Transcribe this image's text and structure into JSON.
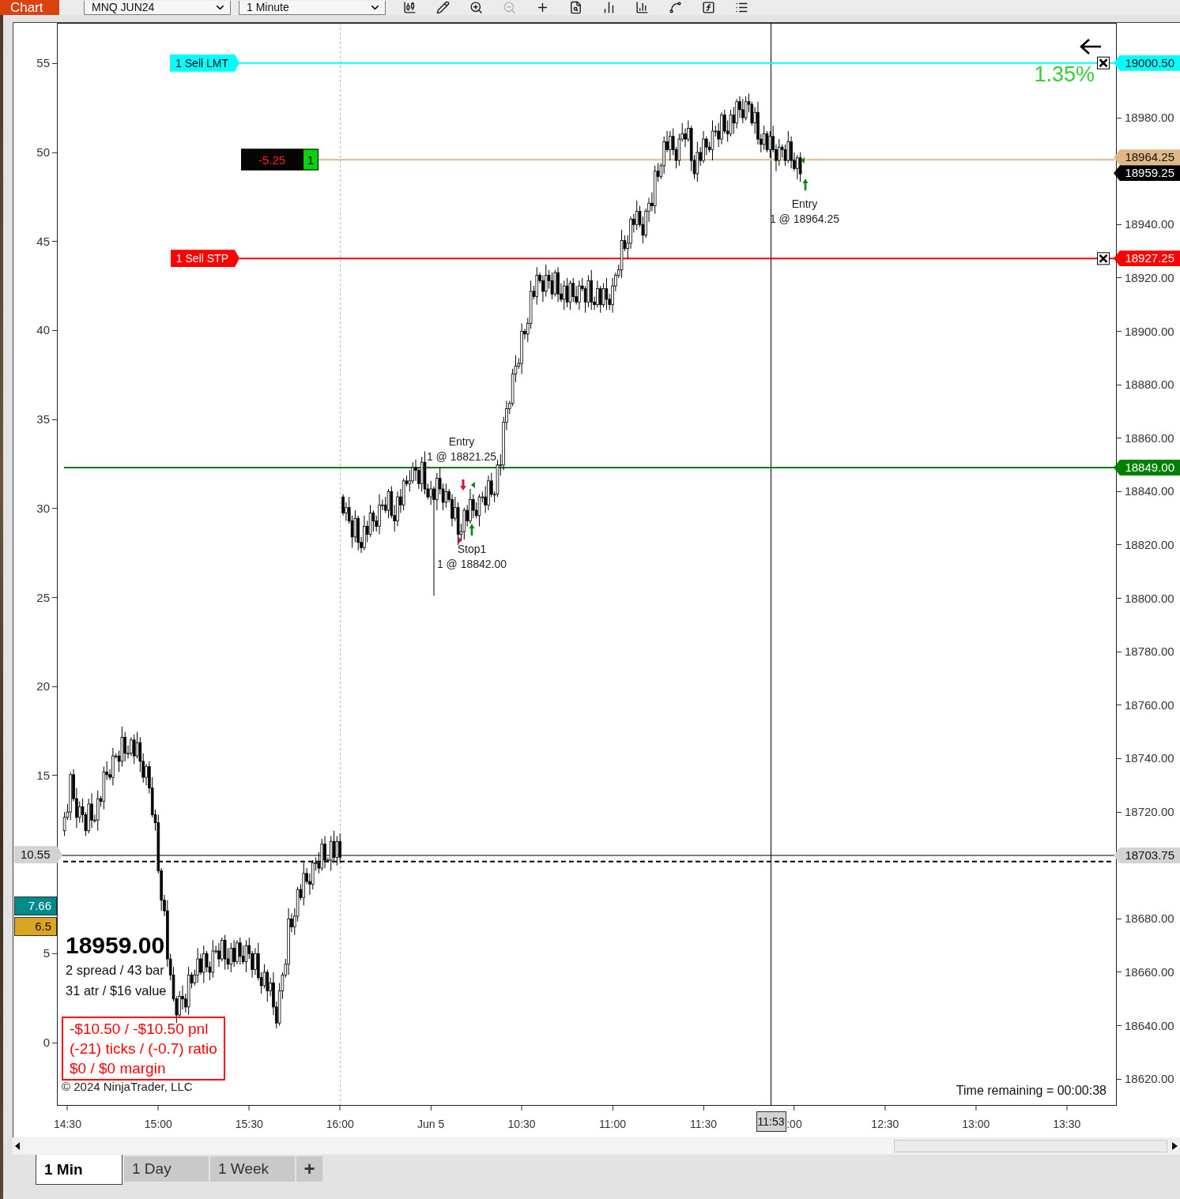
{
  "toolbar": {
    "title": "Chart",
    "instrument": "MNQ JUN24",
    "interval": "1 Minute",
    "buttons": [
      {
        "kind": "candles",
        "disabled": false
      },
      {
        "kind": "pencil",
        "disabled": false
      },
      {
        "kind": "zoom_in",
        "disabled": false
      },
      {
        "kind": "zoom_out",
        "disabled": true
      },
      {
        "kind": "crosshair",
        "disabled": false
      },
      {
        "kind": "data_box",
        "disabled": false
      },
      {
        "kind": "bar",
        "disabled": false
      },
      {
        "kind": "columns",
        "disabled": false
      },
      {
        "kind": "nodes",
        "disabled": false
      },
      {
        "kind": "function",
        "disabled": false
      },
      {
        "kind": "list",
        "disabled": false
      }
    ]
  },
  "chart": {
    "percent": "1.35%",
    "orders": [
      {
        "kind": "limit",
        "label": "1 Sell LMT"
      },
      {
        "kind": "stop",
        "label": "1 Sell STP"
      }
    ],
    "position": {
      "pnl": "-5.25",
      "quantity": "1"
    },
    "last_price": "18959.25",
    "executions": [
      {
        "title": "Entry",
        "detail": "1 @ 18964.25"
      },
      {
        "title": "Entry",
        "detail": "1 @ 18821.25"
      },
      {
        "title": "Stop1",
        "detail": "1 @ 18842.00"
      }
    ],
    "crosshair": {
      "value": "10.55",
      "time": "11:53"
    },
    "left_axis": {
      "ticks": [
        "55",
        "50",
        "45",
        "40",
        "35",
        "30",
        "25",
        "20",
        "15",
        "5",
        "0"
      ],
      "markers": [
        {
          "text": "7.66",
          "color": "#008b8b"
        },
        {
          "text": "6.5",
          "color": "#daa520"
        }
      ]
    },
    "chart_data": {
      "type": "candlestick",
      "ylim": [
        18610,
        19015.5
      ],
      "yticks": [
        {
          "value": 18980,
          "label": "18980.00"
        },
        {
          "value": 18940,
          "label": "18940.00"
        },
        {
          "value": 18920,
          "label": "18920.00"
        },
        {
          "value": 18900,
          "label": "18900.00"
        },
        {
          "value": 18880,
          "label": "18880.00"
        },
        {
          "value": 18860,
          "label": "18860.00"
        },
        {
          "value": 18840,
          "label": "18840.00"
        },
        {
          "value": 18820,
          "label": "18820.00"
        },
        {
          "value": 18800,
          "label": "18800.00"
        },
        {
          "value": 18780,
          "label": "18780.00"
        },
        {
          "value": 18760,
          "label": "18760.00"
        },
        {
          "value": 18740,
          "label": "18740.00"
        },
        {
          "value": 18720,
          "label": "18720.00"
        },
        {
          "value": 18680,
          "label": "18680.00"
        },
        {
          "value": 18660,
          "label": "18660.00"
        },
        {
          "value": 18640,
          "label": "18640.00"
        },
        {
          "value": 18620,
          "label": "18620.00"
        }
      ],
      "ref_lines": [
        {
          "axis": "y",
          "value": 19000.5,
          "label": "19000.50",
          "color": "#00ffff"
        },
        {
          "axis": "y",
          "value": 18964.25,
          "label": "18964.25",
          "color": "#deb887"
        },
        {
          "axis": "y",
          "value": 18927.25,
          "label": "18927.25",
          "color": "#ff0000"
        },
        {
          "axis": "y",
          "value": 18849,
          "label": "18849.00",
          "color": "#008000"
        },
        {
          "axis": "y",
          "value": 18703.75,
          "label": "18703.75",
          "color": "#000000"
        },
        {
          "axis": "y",
          "value": 18701.5,
          "color": "#000000"
        }
      ],
      "categories": [
        null,
        null,
        null,
        "14:30",
        null,
        null,
        null,
        null,
        null,
        null,
        null,
        null,
        null,
        null,
        null,
        null,
        null,
        null,
        null,
        null,
        null,
        null,
        null,
        null,
        null,
        null,
        null,
        null,
        null,
        null,
        null,
        null,
        null,
        "15:00",
        null,
        null,
        null,
        null,
        null,
        null,
        null,
        null,
        null,
        null,
        null,
        null,
        null,
        null,
        null,
        null,
        null,
        null,
        null,
        null,
        null,
        null,
        null,
        null,
        null,
        null,
        null,
        null,
        null,
        "15:30",
        null,
        null,
        null,
        null,
        null,
        null,
        null,
        null,
        null,
        null,
        null,
        null,
        null,
        null,
        null,
        null,
        null,
        null,
        null,
        null,
        null,
        null,
        null,
        null,
        null,
        null,
        null,
        null,
        null,
        "16:00",
        null,
        null,
        null,
        null,
        null,
        null,
        null,
        null,
        null,
        null,
        null,
        null,
        null,
        null,
        null,
        null,
        null,
        null,
        null,
        null,
        null,
        null,
        null,
        null,
        null,
        null,
        null,
        null,
        null,
        "Jun 5",
        null,
        null,
        null,
        null,
        null,
        null,
        null,
        null,
        null,
        null,
        null,
        null,
        null,
        null,
        null,
        null,
        null,
        null,
        null,
        null,
        null,
        null,
        null,
        null,
        null,
        null,
        null,
        null,
        null,
        "10:30",
        null,
        null,
        null,
        null,
        null,
        null,
        null,
        null,
        null,
        null,
        null,
        null,
        null,
        null,
        null,
        null,
        null,
        null,
        null,
        null,
        null,
        null,
        null,
        null,
        null,
        null,
        null,
        null,
        null,
        "11:00",
        null,
        null,
        null,
        null,
        null,
        null,
        null,
        null,
        null,
        null,
        null,
        null,
        null,
        null,
        null,
        null,
        null,
        null,
        null,
        null,
        null,
        null,
        null,
        null,
        null,
        null,
        null,
        null,
        null,
        "11:30",
        null,
        null,
        null,
        null,
        null,
        null,
        null,
        null,
        null,
        null,
        null,
        null,
        null,
        null,
        null,
        null,
        null,
        null,
        null,
        null,
        null,
        null,
        null,
        null,
        null,
        null,
        null,
        null,
        null,
        ":00",
        null,
        null,
        null,
        null,
        null,
        null,
        null,
        null,
        null,
        null,
        null,
        null,
        null,
        null,
        null,
        null,
        null,
        null,
        null,
        null,
        null,
        null,
        null,
        null,
        null,
        null,
        null,
        null,
        null,
        "12:30",
        null,
        null,
        null,
        null,
        null,
        null,
        null,
        null,
        null,
        null,
        null,
        null,
        null,
        null,
        null,
        null,
        null,
        null,
        null,
        null,
        null,
        null,
        null,
        null,
        null,
        null,
        null,
        null,
        null,
        "13:00",
        null,
        null,
        null,
        null,
        null,
        null,
        null,
        null,
        null,
        null,
        null,
        null,
        null,
        null,
        null,
        null,
        null,
        null,
        null,
        null,
        null,
        null,
        null,
        null,
        null,
        null,
        null,
        null,
        null,
        "13:30",
        null,
        null,
        null,
        null,
        null,
        null,
        null,
        null,
        null,
        null,
        null,
        null,
        null,
        null,
        null,
        null
      ],
      "ohlc": [
        null,
        null,
        [
          18713,
          18720,
          18711,
          18718
        ],
        [
          18718,
          18723,
          18717,
          18720
        ],
        [
          18720,
          18735,
          18717,
          18734
        ],
        [
          18734,
          18736,
          18724,
          18725
        ],
        [
          18725,
          18729,
          18714,
          18718
        ],
        [
          18718,
          18724,
          18716,
          18722
        ],
        [
          18722,
          18725,
          18716,
          18719
        ],
        [
          18719,
          18720,
          18711,
          18713
        ],
        [
          18713,
          18725,
          18712,
          18723
        ],
        [
          18723,
          18727,
          18714,
          18717
        ],
        [
          18717,
          18719,
          18716,
          18717
        ],
        [
          18717,
          18728,
          18713,
          18725
        ],
        [
          18725,
          18726,
          18722,
          18724
        ],
        [
          18724,
          18737,
          18721,
          18735
        ],
        [
          18735,
          18739,
          18732,
          18734
        ],
        [
          18734,
          18736,
          18732,
          18733
        ],
        [
          18733,
          18744,
          18730,
          18741
        ],
        [
          18741,
          18742,
          18740,
          18741
        ],
        [
          18741,
          18743,
          18735,
          18739
        ],
        [
          18739,
          18752,
          18737,
          18748
        ],
        [
          18748,
          18750,
          18739,
          18742
        ],
        [
          18742,
          18745,
          18740,
          18742
        ],
        [
          18742,
          18748,
          18741,
          18747
        ],
        [
          18747,
          18749,
          18738,
          18741
        ],
        [
          18741,
          18750,
          18740,
          18746
        ],
        [
          18746,
          18748,
          18735,
          18739
        ],
        [
          18739,
          18742,
          18731,
          18733
        ],
        [
          18733,
          18738,
          18730,
          18737
        ],
        [
          18737,
          18739,
          18727,
          18729
        ],
        [
          18729,
          18733,
          18718,
          18719
        ],
        [
          18719,
          18721,
          18713,
          18716
        ],
        [
          18716,
          18719,
          18697,
          18698
        ],
        [
          18698,
          18699,
          18683,
          18687
        ],
        [
          18687,
          18689,
          18681,
          18683
        ],
        [
          18683,
          18687,
          18662,
          18665
        ],
        [
          18665,
          18667,
          18657,
          18659
        ],
        [
          18659,
          18662,
          18649,
          18650
        ],
        [
          18650,
          18651,
          18641,
          18644
        ],
        [
          18644,
          18653,
          18643,
          18651
        ],
        [
          18651,
          18655,
          18646,
          18650
        ],
        [
          18650,
          18652,
          18645,
          18647
        ],
        [
          18647,
          18662,
          18644,
          18659
        ],
        [
          18659,
          18660,
          18654,
          18656
        ],
        [
          18656,
          18661,
          18655,
          18659
        ],
        [
          18659,
          18669,
          18656,
          18665
        ],
        [
          18665,
          18667,
          18659,
          18660
        ],
        [
          18660,
          18670,
          18656,
          18667
        ],
        [
          18667,
          18668,
          18660,
          18662
        ],
        [
          18662,
          18664,
          18657,
          18660
        ],
        [
          18660,
          18672,
          18658,
          18668
        ],
        [
          18668,
          18670,
          18667,
          18668
        ],
        [
          18668,
          18671,
          18662,
          18665
        ],
        [
          18665,
          18673,
          18664,
          18672
        ],
        [
          18672,
          18674,
          18661,
          18665
        ],
        [
          18665,
          18669,
          18661,
          18663
        ],
        [
          18663,
          18671,
          18660,
          18669
        ],
        [
          18669,
          18672,
          18662,
          18664
        ],
        [
          18664,
          18672,
          18663,
          18671
        ],
        [
          18671,
          18673,
          18663,
          18666
        ],
        [
          18666,
          18670,
          18663,
          18664
        ],
        [
          18664,
          18672,
          18660,
          18670
        ],
        [
          18670,
          18673,
          18665,
          18667
        ],
        [
          18667,
          18668,
          18658,
          18661
        ],
        [
          18661,
          18669,
          18659,
          18667
        ],
        [
          18667,
          18671,
          18657,
          18658
        ],
        [
          18658,
          18660,
          18652,
          18655
        ],
        [
          18655,
          18663,
          18654,
          18660
        ],
        [
          18660,
          18661,
          18649,
          18653
        ],
        [
          18653,
          18658,
          18651,
          18656
        ],
        [
          18656,
          18660,
          18644,
          18647
        ],
        [
          18647,
          18649,
          18639,
          18641
        ],
        [
          18641,
          18656,
          18640,
          18653
        ],
        [
          18653,
          18660,
          18650,
          18659
        ],
        [
          18659,
          18665,
          18658,
          18663
        ],
        [
          18663,
          18684,
          18659,
          18680
        ],
        [
          18680,
          18682,
          18675,
          18677
        ],
        [
          18677,
          18684,
          18674,
          18681
        ],
        [
          18681,
          18692,
          18679,
          18691
        ],
        [
          18691,
          18693,
          18687,
          18688
        ],
        [
          18688,
          18701,
          18685,
          18697
        ],
        [
          18697,
          18699,
          18693,
          18694
        ],
        [
          18694,
          18697,
          18689,
          18693
        ],
        [
          18693,
          18702,
          18691,
          18701
        ],
        [
          18701,
          18703,
          18698,
          18701
        ],
        [
          18701,
          18705,
          18697,
          18699
        ],
        [
          18699,
          18710,
          18698,
          18708
        ],
        [
          18708,
          18711,
          18699,
          18702
        ],
        [
          18702,
          18703,
          18701,
          18702
        ],
        [
          18702,
          18711,
          18698,
          18709
        ],
        [
          18709,
          18713,
          18701,
          18703
        ],
        [
          18703,
          18711,
          18700,
          18709
        ],
        [
          18709,
          18712,
          18701,
          18703
        ],
        [
          18838,
          18839,
          18831,
          18832
        ],
        [
          18832,
          18836,
          18829,
          18834
        ],
        [
          18834,
          18838,
          18828,
          18829
        ],
        [
          18829,
          18831,
          18819,
          18823
        ],
        [
          18823,
          18833,
          18821,
          18830
        ],
        [
          18830,
          18831,
          18818,
          18821
        ],
        [
          18821,
          18823,
          18817,
          18819
        ],
        [
          18819,
          18831,
          18818,
          18827
        ],
        [
          18827,
          18829,
          18821,
          18824
        ],
        [
          18824,
          18835,
          18823,
          18832
        ],
        [
          18832,
          18833,
          18825,
          18829
        ],
        [
          18829,
          18831,
          18825,
          18827
        ],
        [
          18827,
          18839,
          18824,
          18835
        ],
        [
          18835,
          18837,
          18833,
          18835
        ],
        [
          18835,
          18838,
          18832,
          18833
        ],
        [
          18833,
          18841,
          18830,
          18840
        ],
        [
          18840,
          18842,
          18830,
          18831
        ],
        [
          18831,
          18835,
          18825,
          18829
        ],
        [
          18829,
          18840,
          18827,
          18838
        ],
        [
          18838,
          18841,
          18832,
          18835
        ],
        [
          18835,
          18845,
          18833,
          18844
        ],
        [
          18844,
          18846,
          18842,
          18843
        ],
        [
          18843,
          18848,
          18840,
          18844
        ],
        [
          18844,
          18851,
          18843,
          18849
        ],
        [
          18849,
          18852,
          18844,
          18848
        ],
        [
          18848,
          18849,
          18841,
          18843
        ],
        [
          18843,
          18853,
          18840,
          18851
        ],
        [
          18851,
          18855,
          18839,
          18841
        ],
        [
          18841,
          18843,
          18837,
          18838
        ],
        [
          18838,
          18844,
          18835,
          18841
        ],
        [
          18841,
          18842,
          18801,
          18837
        ],
        [
          18837,
          18847,
          18833,
          18845
        ],
        [
          18845,
          18849,
          18839,
          18841
        ],
        [
          18841,
          18843,
          18833,
          18836
        ],
        [
          18836,
          18843,
          18834,
          18840
        ],
        [
          18840,
          18841,
          18836,
          18837
        ],
        [
          18837,
          18839,
          18827,
          18830
        ],
        [
          18830,
          18838,
          18829,
          18834
        ],
        [
          18834,
          18836,
          18820,
          18824
        ],
        [
          18824,
          18828,
          18822,
          18825
        ],
        [
          18825,
          18834,
          18822,
          18833
        ],
        [
          18833,
          18835,
          18827,
          18829
        ],
        [
          18829,
          18841,
          18828,
          18837
        ],
        [
          18837,
          18839,
          18830,
          18833
        ],
        [
          18833,
          18836,
          18830,
          18831
        ],
        [
          18831,
          18839,
          18827,
          18838
        ],
        [
          18838,
          18840,
          18836,
          18838
        ],
        [
          18838,
          18842,
          18832,
          18835
        ],
        [
          18835,
          18846,
          18833,
          18844
        ],
        [
          18844,
          18847,
          18838,
          18839
        ],
        [
          18839,
          18840,
          18836,
          18839
        ],
        [
          18839,
          18852,
          18838,
          18850
        ],
        [
          18850,
          18854,
          18846,
          18850
        ],
        [
          18850,
          18868,
          18848,
          18866
        ],
        [
          18866,
          18874,
          18863,
          18871
        ],
        [
          18871,
          18874,
          18869,
          18873
        ],
        [
          18873,
          18886,
          18872,
          18884
        ],
        [
          18884,
          18891,
          18881,
          18887
        ],
        [
          18887,
          18890,
          18886,
          18888
        ],
        [
          18888,
          18903,
          18884,
          18900
        ],
        [
          18900,
          18901,
          18897,
          18899
        ],
        [
          18899,
          18905,
          18896,
          18903
        ],
        [
          18903,
          18919,
          18901,
          18915
        ],
        [
          18915,
          18917,
          18912,
          18913
        ],
        [
          18913,
          18924,
          18910,
          18921
        ],
        [
          18921,
          18922,
          18918,
          18919
        ],
        [
          18919,
          18921,
          18911,
          18915
        ],
        [
          18915,
          18925,
          18913,
          18921
        ],
        [
          18921,
          18923,
          18916,
          18919
        ],
        [
          18919,
          18922,
          18912,
          18914
        ],
        [
          18914,
          18923,
          18913,
          18922
        ],
        [
          18922,
          18924,
          18911,
          18914
        ],
        [
          18914,
          18918,
          18911,
          18912
        ],
        [
          18912,
          18919,
          18908,
          18917
        ],
        [
          18917,
          18920,
          18909,
          18911
        ],
        [
          18911,
          18919,
          18908,
          18918
        ],
        [
          18918,
          18920,
          18911,
          18913
        ],
        [
          18913,
          18917,
          18910,
          18911
        ],
        [
          18911,
          18919,
          18908,
          18917
        ],
        [
          18917,
          18920,
          18915,
          18916
        ],
        [
          18916,
          18917,
          18907,
          18911
        ],
        [
          18911,
          18921,
          18909,
          18919
        ],
        [
          18919,
          18923,
          18908,
          18911
        ],
        [
          18911,
          18913,
          18908,
          18910
        ],
        [
          18910,
          18919,
          18909,
          18916
        ],
        [
          18916,
          18917,
          18907,
          18910
        ],
        [
          18910,
          18918,
          18909,
          18916
        ],
        [
          18916,
          18920,
          18908,
          18912
        ],
        [
          18912,
          18914,
          18908,
          18910
        ],
        [
          18910,
          18920,
          18907,
          18917
        ],
        [
          18917,
          18922,
          18915,
          18921
        ],
        [
          18921,
          18925,
          18920,
          18923
        ],
        [
          18923,
          18938,
          18920,
          18934
        ],
        [
          18934,
          18936,
          18930,
          18931
        ],
        [
          18931,
          18936,
          18927,
          18933
        ],
        [
          18933,
          18943,
          18931,
          18942
        ],
        [
          18942,
          18944,
          18937,
          18940
        ],
        [
          18940,
          18949,
          18938,
          18945
        ],
        [
          18945,
          18947,
          18939,
          18940
        ],
        [
          18940,
          18943,
          18933,
          18936
        ],
        [
          18936,
          18946,
          18935,
          18945
        ],
        [
          18945,
          18950,
          18941,
          18948
        ],
        [
          18948,
          18952,
          18945,
          18947
        ],
        [
          18947,
          18962,
          18944,
          18960
        ],
        [
          18960,
          18963,
          18956,
          18958
        ],
        [
          18958,
          18963,
          18957,
          18962
        ],
        [
          18962,
          18973,
          18959,
          18971
        ],
        [
          18971,
          18975,
          18967,
          18968
        ],
        [
          18968,
          18975,
          18964,
          18973
        ],
        [
          18973,
          18976,
          18966,
          18968
        ],
        [
          18968,
          18969,
          18961,
          18964
        ],
        [
          18964,
          18974,
          18962,
          18972
        ],
        [
          18972,
          18978,
          18971,
          18974
        ],
        [
          18974,
          18976,
          18969,
          18972
        ],
        [
          18972,
          18979,
          18971,
          18976
        ],
        [
          18976,
          18977,
          18960,
          18964
        ],
        [
          18964,
          18966,
          18957,
          18959
        ],
        [
          18959,
          18971,
          18956,
          18967
        ],
        [
          18967,
          18969,
          18962,
          18964
        ],
        [
          18964,
          18975,
          18963,
          18972
        ],
        [
          18972,
          18973,
          18966,
          18969
        ],
        [
          18969,
          18971,
          18967,
          18968
        ],
        [
          18968,
          18979,
          18964,
          18975
        ],
        [
          18975,
          18977,
          18973,
          18975
        ],
        [
          18975,
          18978,
          18969,
          18972
        ],
        [
          18972,
          18982,
          18970,
          18981
        ],
        [
          18981,
          18983,
          18974,
          18975
        ],
        [
          18975,
          18979,
          18971,
          18974
        ],
        [
          18974,
          18983,
          18973,
          18981
        ],
        [
          18981,
          18984,
          18974,
          18978
        ],
        [
          18978,
          18987,
          18976,
          18986
        ],
        [
          18986,
          18988,
          18980,
          18983
        ],
        [
          18983,
          18987,
          18978,
          18980
        ],
        [
          18980,
          18988,
          18979,
          18986
        ],
        [
          18986,
          18989,
          18982,
          18985
        ],
        [
          18985,
          18986,
          18977,
          18978
        ],
        [
          18978,
          18984,
          18974,
          18982
        ],
        [
          18982,
          18986,
          18970,
          18972
        ],
        [
          18972,
          18974,
          18967,
          18970
        ],
        [
          18970,
          18977,
          18968,
          18974
        ],
        [
          18974,
          18975,
          18967,
          18968
        ],
        [
          18968,
          18975,
          18965,
          18973
        ],
        [
          18973,
          18977,
          18967,
          18968
        ],
        [
          18968,
          18970,
          18960,
          18964
        ],
        [
          18964,
          18972,
          18962,
          18969
        ],
        [
          18969,
          18970,
          18965,
          18968
        ],
        [
          18968,
          18970,
          18962,
          18964
        ],
        [
          18964,
          18975,
          18963,
          18971
        ],
        [
          18971,
          18973,
          18961,
          18964
        ],
        [
          18964,
          18967,
          18960,
          18961
        ],
        [
          18961,
          18966,
          18957,
          18965
        ],
        [
          18965,
          18967,
          18956,
          18959
        ],
        null,
        null,
        null,
        null,
        null,
        null,
        null,
        null,
        null,
        null,
        null,
        null,
        null,
        null,
        null,
        null,
        null,
        null,
        null,
        null,
        null,
        null,
        null,
        null,
        null,
        null,
        null,
        null,
        null,
        null,
        null,
        null,
        null,
        null,
        null,
        null,
        null,
        null,
        null,
        null,
        null,
        null,
        null,
        null,
        null,
        null,
        null,
        null,
        null,
        null,
        null,
        null,
        null,
        null,
        null,
        null,
        null,
        null,
        null,
        null,
        null,
        null,
        null,
        null,
        null,
        null,
        null,
        null,
        null,
        null,
        null,
        null,
        null,
        null,
        null,
        null,
        null,
        null,
        null,
        null,
        null,
        null,
        null,
        null,
        null,
        null,
        null,
        null,
        null,
        null,
        null,
        null,
        null,
        null,
        null,
        null,
        null,
        null,
        null,
        null,
        null,
        null,
        null,
        null
      ]
    },
    "info": {
      "price": "18959.00",
      "lines": [
        "2 spread / 43 bar",
        "31 atr / $16 value"
      ],
      "pnl_lines": [
        "-$10.50 / -$10.50 pnl",
        "(-21) ticks / (-0.7) ratio",
        "$0 / $0 margin"
      ],
      "copyright": "© 2024 NinjaTrader, LLC"
    },
    "time_remaining": "Time remaining = 00:00:38"
  },
  "tabs": [
    {
      "label": "1 Min",
      "selected": true
    },
    {
      "label": "1 Day",
      "selected": false
    },
    {
      "label": "1 Week",
      "selected": false
    }
  ],
  "add_tab": "+"
}
